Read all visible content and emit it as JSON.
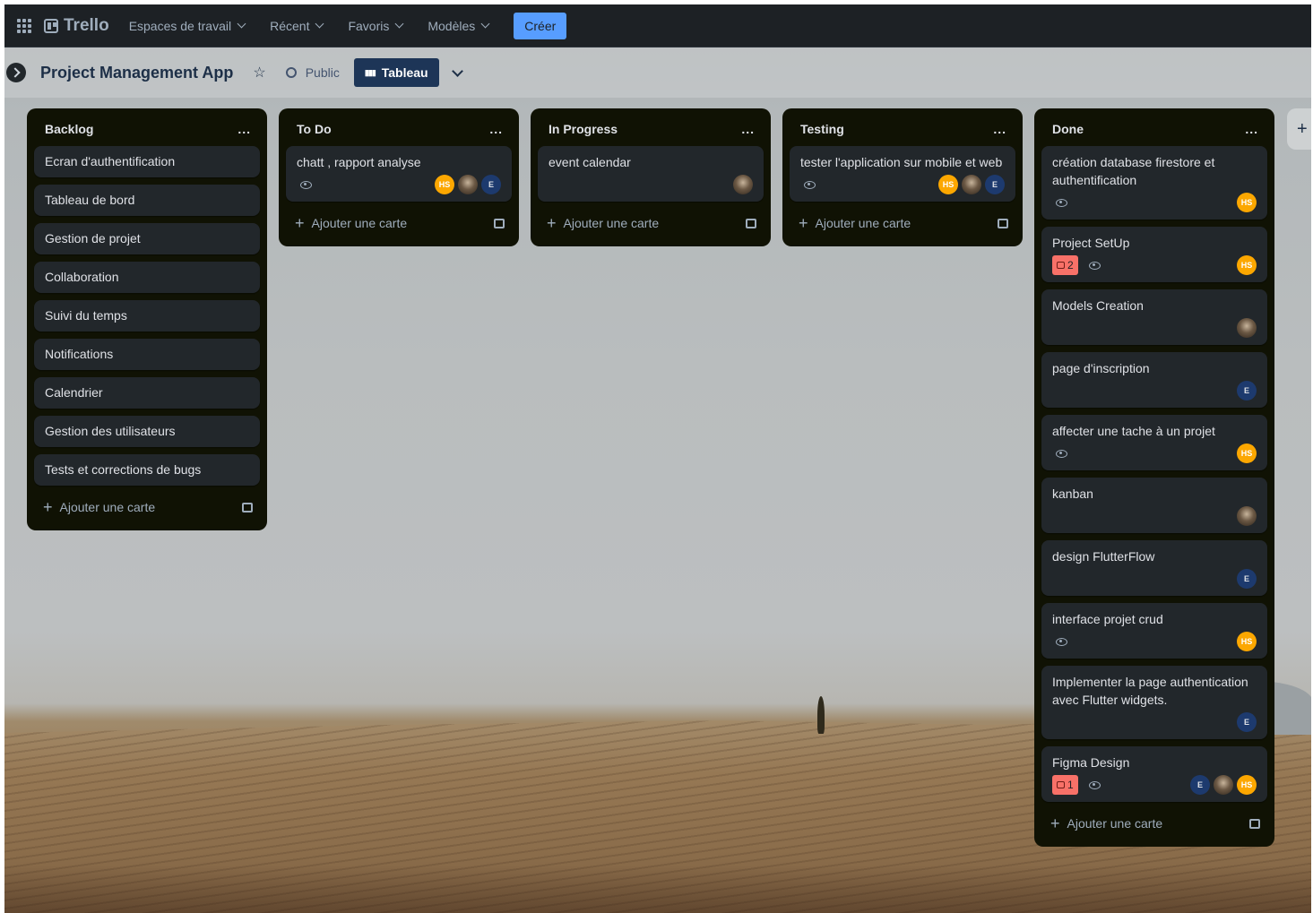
{
  "nav": {
    "logo": "Trello",
    "items": [
      "Espaces de travail",
      "Récent",
      "Favoris",
      "Modèles"
    ],
    "create_label": "Créer"
  },
  "board": {
    "title": "Project Management App",
    "visibility": "Public",
    "view": "Tableau"
  },
  "add_card_label": "Ajouter une carte",
  "lists": [
    {
      "title": "Backlog",
      "cards": [
        "Ecran d'authentification",
        "Tableau de bord",
        "Gestion de projet",
        "Collaboration",
        "Suivi du temps",
        "Notifications",
        "Calendrier",
        "Gestion des utilisateurs",
        "Tests et corrections de bugs"
      ]
    },
    {
      "title": "To Do",
      "cards": [
        {
          "title": "chatt , rapport analyse",
          "watch": true,
          "members": [
            "HS",
            "photo",
            "E"
          ]
        }
      ]
    },
    {
      "title": "In Progress",
      "cards": [
        {
          "title": "event calendar",
          "watch": false,
          "members": [
            "photo"
          ]
        }
      ]
    },
    {
      "title": "Testing",
      "cards": [
        {
          "title": "tester l'application sur mobile et web",
          "watch": true,
          "members": [
            "HS",
            "photo",
            "E"
          ]
        }
      ]
    },
    {
      "title": "Done",
      "cards": [
        {
          "title": "création database firestore et authentification",
          "watch": true,
          "members": [
            "HS"
          ]
        },
        {
          "title": "Project SetUp",
          "comments": "2",
          "watch": true,
          "members": [
            "HS"
          ]
        },
        {
          "title": "Models Creation",
          "members": [
            "photo"
          ]
        },
        {
          "title": "page d'inscription",
          "members": [
            "E"
          ]
        },
        {
          "title": "affecter une tache à un projet",
          "watch": true,
          "members": [
            "HS"
          ]
        },
        {
          "title": "kanban",
          "members": [
            "photo"
          ]
        },
        {
          "title": "design FlutterFlow",
          "members": [
            "E"
          ]
        },
        {
          "title": "interface projet crud",
          "watch": true,
          "members": [
            "HS"
          ]
        },
        {
          "title": "Implementer la page authentication avec Flutter widgets.",
          "members": [
            "E"
          ]
        },
        {
          "title": "Figma Design",
          "comments": "1",
          "watch": true,
          "members": [
            "E",
            "photo",
            "HS"
          ]
        }
      ]
    }
  ],
  "list_menu": "...",
  "add_list_symbol": "+",
  "colors": {
    "nav_bg": "#1d2125",
    "list_bg": "#101204",
    "card_bg": "#22272b",
    "create": "#579dff",
    "avatar_hs": "#fca700",
    "avatar_e": "#1d3a6e",
    "comment_badge": "#f87168"
  }
}
